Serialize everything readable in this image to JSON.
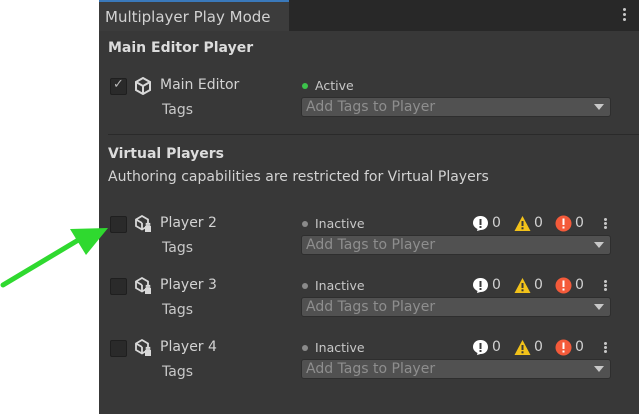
{
  "window": {
    "tab_title": "Multiplayer Play Mode"
  },
  "main_editor": {
    "section_title": "Main Editor Player",
    "player": {
      "name": "Main Editor",
      "checked": true,
      "status": "Active",
      "status_color": "#3cc34b",
      "tags_label": "Tags",
      "tags_placeholder": "Add Tags to Player"
    }
  },
  "virtual_players": {
    "section_title": "Virtual Players",
    "description": "Authoring capabilities are restricted for Virtual Players",
    "players": [
      {
        "name": "Player 2",
        "checked": false,
        "status": "Inactive",
        "status_color": "#8a8a8a",
        "tags_label": "Tags",
        "tags_placeholder": "Add Tags to Player",
        "info_count": "0",
        "warning_count": "0",
        "error_count": "0"
      },
      {
        "name": "Player 3",
        "checked": false,
        "status": "Inactive",
        "status_color": "#8a8a8a",
        "tags_label": "Tags",
        "tags_placeholder": "Add Tags to Player",
        "info_count": "0",
        "warning_count": "0",
        "error_count": "0"
      },
      {
        "name": "Player 4",
        "checked": false,
        "status": "Inactive",
        "status_color": "#8a8a8a",
        "tags_label": "Tags",
        "tags_placeholder": "Add Tags to Player",
        "info_count": "0",
        "warning_count": "0",
        "error_count": "0"
      }
    ]
  },
  "colors": {
    "annotation_arrow": "#2fd92f",
    "accent_tab": "#3a79bb",
    "warning": "#f2c21a",
    "error": "#f45a3a",
    "info": "#ffffff"
  }
}
